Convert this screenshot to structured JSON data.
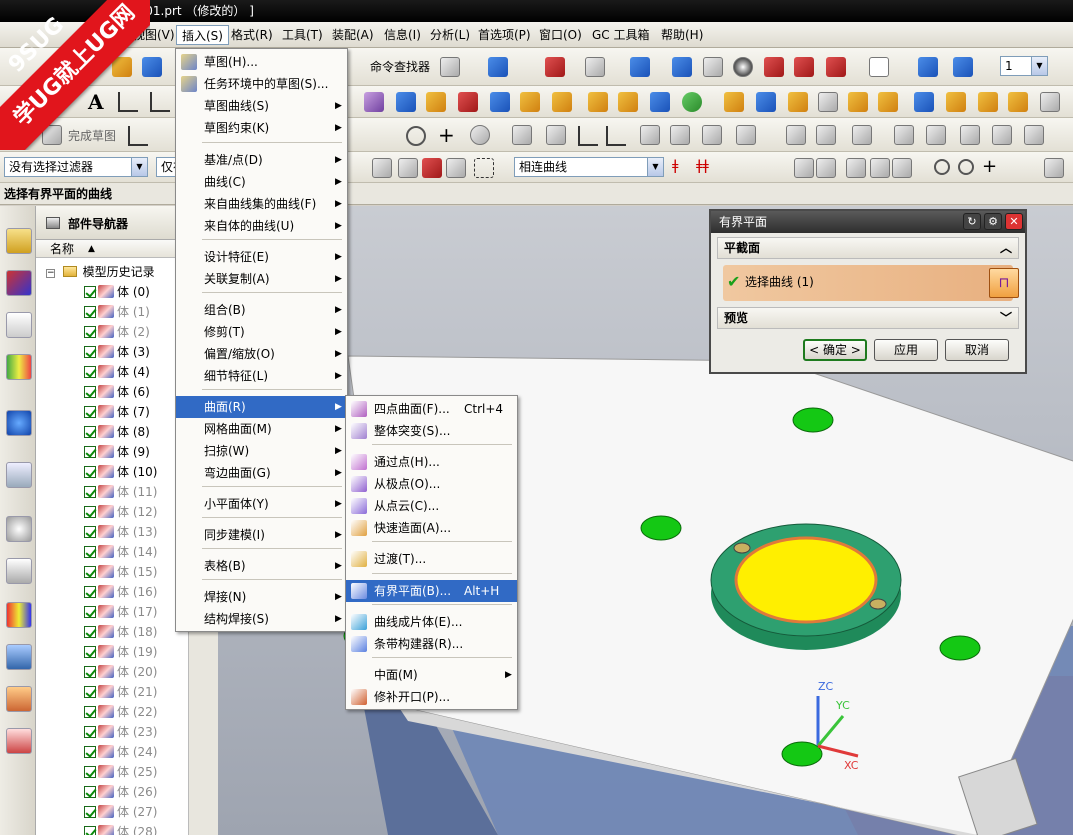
{
  "window": {
    "title": "0301.prt （修改的） ]"
  },
  "watermark": {
    "brand": "9SUG",
    "slogan": "学UG就上UG网"
  },
  "menubar": {
    "items": [
      {
        "label": "视图(V)"
      },
      {
        "label": "插入(S)"
      },
      {
        "label": "格式(R)"
      },
      {
        "label": "工具(T)"
      },
      {
        "label": "装配(A)"
      },
      {
        "label": "信息(I)"
      },
      {
        "label": "分析(L)"
      },
      {
        "label": "首选项(P)"
      },
      {
        "label": "窗口(O)"
      },
      {
        "label": "GC 工具箱"
      },
      {
        "label": "帮助(H)"
      }
    ]
  },
  "toolbar": {
    "command_finder": "命令查找器",
    "finish_sketch": "完成草图",
    "layer_value": "1",
    "filter_combo": "没有选择过滤器",
    "scope_combo": "仅在",
    "curve_rule_combo": "相连曲线"
  },
  "prompt": {
    "text": "选择有界平面的曲线"
  },
  "navigator": {
    "title": "部件导航器",
    "column_name": "名称",
    "root": "模型历史记录",
    "rows": [
      {
        "label": "体 (0)",
        "greyed": false
      },
      {
        "label": "体 (1)",
        "greyed": true
      },
      {
        "label": "体 (2)",
        "greyed": true
      },
      {
        "label": "体 (3)",
        "greyed": false
      },
      {
        "label": "体 (4)",
        "greyed": false
      },
      {
        "label": "体 (6)",
        "greyed": false
      },
      {
        "label": "体 (7)",
        "greyed": false
      },
      {
        "label": "体 (8)",
        "greyed": false
      },
      {
        "label": "体 (9)",
        "greyed": false
      },
      {
        "label": "体 (10)",
        "greyed": false
      },
      {
        "label": "体 (11)",
        "greyed": true
      },
      {
        "label": "体 (12)",
        "greyed": true
      },
      {
        "label": "体 (13)",
        "greyed": true
      },
      {
        "label": "体 (14)",
        "greyed": true
      },
      {
        "label": "体 (15)",
        "greyed": true
      },
      {
        "label": "体 (16)",
        "greyed": true
      },
      {
        "label": "体 (17)",
        "greyed": true
      },
      {
        "label": "体 (18)",
        "greyed": true
      },
      {
        "label": "体 (19)",
        "greyed": true
      },
      {
        "label": "体 (20)",
        "greyed": true
      },
      {
        "label": "体 (21)",
        "greyed": true
      },
      {
        "label": "体 (22)",
        "greyed": true
      },
      {
        "label": "体 (23)",
        "greyed": true
      },
      {
        "label": "体 (24)",
        "greyed": true
      },
      {
        "label": "体 (25)",
        "greyed": true
      },
      {
        "label": "体 (26)",
        "greyed": true
      },
      {
        "label": "体 (27)",
        "greyed": true
      },
      {
        "label": "体 (28)",
        "greyed": true
      }
    ]
  },
  "insert_menu": {
    "items": [
      {
        "label": "草图(H)...",
        "sub": false
      },
      {
        "label": "任务环境中的草图(S)...",
        "sub": false
      },
      {
        "label": "草图曲线(S)",
        "sub": true
      },
      {
        "label": "草图约束(K)",
        "sub": true
      },
      {
        "label": "基准/点(D)",
        "sub": true
      },
      {
        "label": "曲线(C)",
        "sub": true
      },
      {
        "label": "来自曲线集的曲线(F)",
        "sub": true
      },
      {
        "label": "来自体的曲线(U)",
        "sub": true
      },
      {
        "label": "设计特征(E)",
        "sub": true
      },
      {
        "label": "关联复制(A)",
        "sub": true
      },
      {
        "label": "组合(B)",
        "sub": true
      },
      {
        "label": "修剪(T)",
        "sub": true
      },
      {
        "label": "偏置/缩放(O)",
        "sub": true
      },
      {
        "label": "细节特征(L)",
        "sub": true
      },
      {
        "label": "曲面(R)",
        "sub": true
      },
      {
        "label": "网格曲面(M)",
        "sub": true
      },
      {
        "label": "扫掠(W)",
        "sub": true
      },
      {
        "label": "弯边曲面(G)",
        "sub": true
      },
      {
        "label": "小平面体(Y)",
        "sub": true
      },
      {
        "label": "同步建模(I)",
        "sub": true
      },
      {
        "label": "表格(B)",
        "sub": true
      },
      {
        "label": "焊接(N)",
        "sub": true
      },
      {
        "label": "结构焊接(S)",
        "sub": true
      }
    ]
  },
  "surface_submenu": {
    "items": [
      {
        "label": "四点曲面(F)...",
        "shortcut": "Ctrl+4",
        "sub": false
      },
      {
        "label": "整体突变(S)...",
        "shortcut": "",
        "sub": false
      },
      {
        "label": "通过点(H)...",
        "shortcut": "",
        "sub": false
      },
      {
        "label": "从极点(O)...",
        "shortcut": "",
        "sub": false
      },
      {
        "label": "从点云(C)...",
        "shortcut": "",
        "sub": false
      },
      {
        "label": "快速造面(A)...",
        "shortcut": "",
        "sub": false
      },
      {
        "label": "过渡(T)...",
        "shortcut": "",
        "sub": false
      },
      {
        "label": "有界平面(B)...",
        "shortcut": "Alt+H",
        "sub": false
      },
      {
        "label": "曲线成片体(E)...",
        "shortcut": "",
        "sub": false
      },
      {
        "label": "条带构建器(R)...",
        "shortcut": "",
        "sub": false
      },
      {
        "label": "中面(M)",
        "shortcut": "",
        "sub": true
      },
      {
        "label": "修补开口(P)...",
        "shortcut": "",
        "sub": false
      }
    ]
  },
  "dialog": {
    "title": "有界平面",
    "section_plane": "平截面",
    "select_curve": "选择曲线 (1)",
    "section_preview": "预览",
    "ok": "< 确定 >",
    "apply": "应用",
    "cancel": "取消"
  },
  "triad": {
    "zc": "ZC",
    "yc": "YC",
    "xc": "XC"
  },
  "colors": {
    "menu_highlight": "#316ac5",
    "watermark": "#e1151c",
    "boss_yellow": "#ffef00",
    "boss_green": "#2ea070"
  }
}
